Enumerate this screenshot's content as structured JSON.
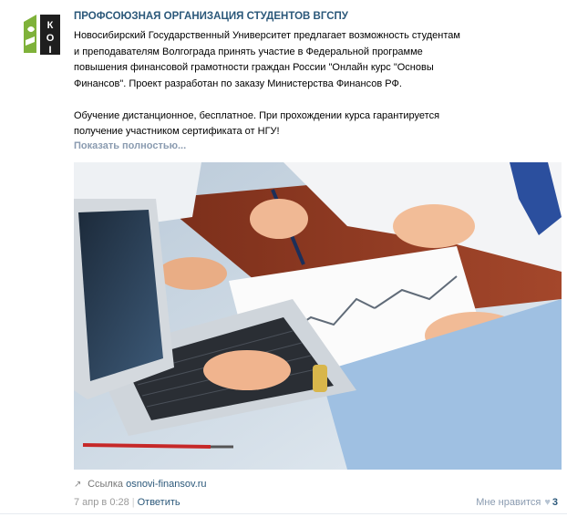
{
  "post": {
    "author": "ПРОФСОЮЗНАЯ ОРГАНИЗАЦИЯ СТУДЕНТОВ ВГСПУ",
    "paragraph1_lines": [
      "Новосибирский Государственный Университет предлагает возможность студентам",
      "и преподавателям Волгограда принять участие в Федеральной программе",
      "повышения финансовой грамотности граждан России \"Онлайн курс \"Основы",
      "Финансов\". Проект разработан по заказу Министерства Финансов РФ."
    ],
    "paragraph2_lines": [
      "Обучение дистанционное, бесплатное. При прохождении курса гарантируется",
      "получение участником сертификата от НГУ!"
    ],
    "show_more": "Показать полностью...",
    "link_label": "Ссылка",
    "link_url": "osnovi-finansov.ru",
    "date": "7 апр в 0:28",
    "separator": "|",
    "reply": "Ответить",
    "likes_label": "Мне нравится",
    "likes_count": "3"
  },
  "colors": {
    "link": "#2b587a",
    "muted": "#999999",
    "show_more": "#8a9bb0"
  },
  "icons": [
    "group-logo-icon",
    "link-arrow-icon",
    "heart-icon"
  ]
}
